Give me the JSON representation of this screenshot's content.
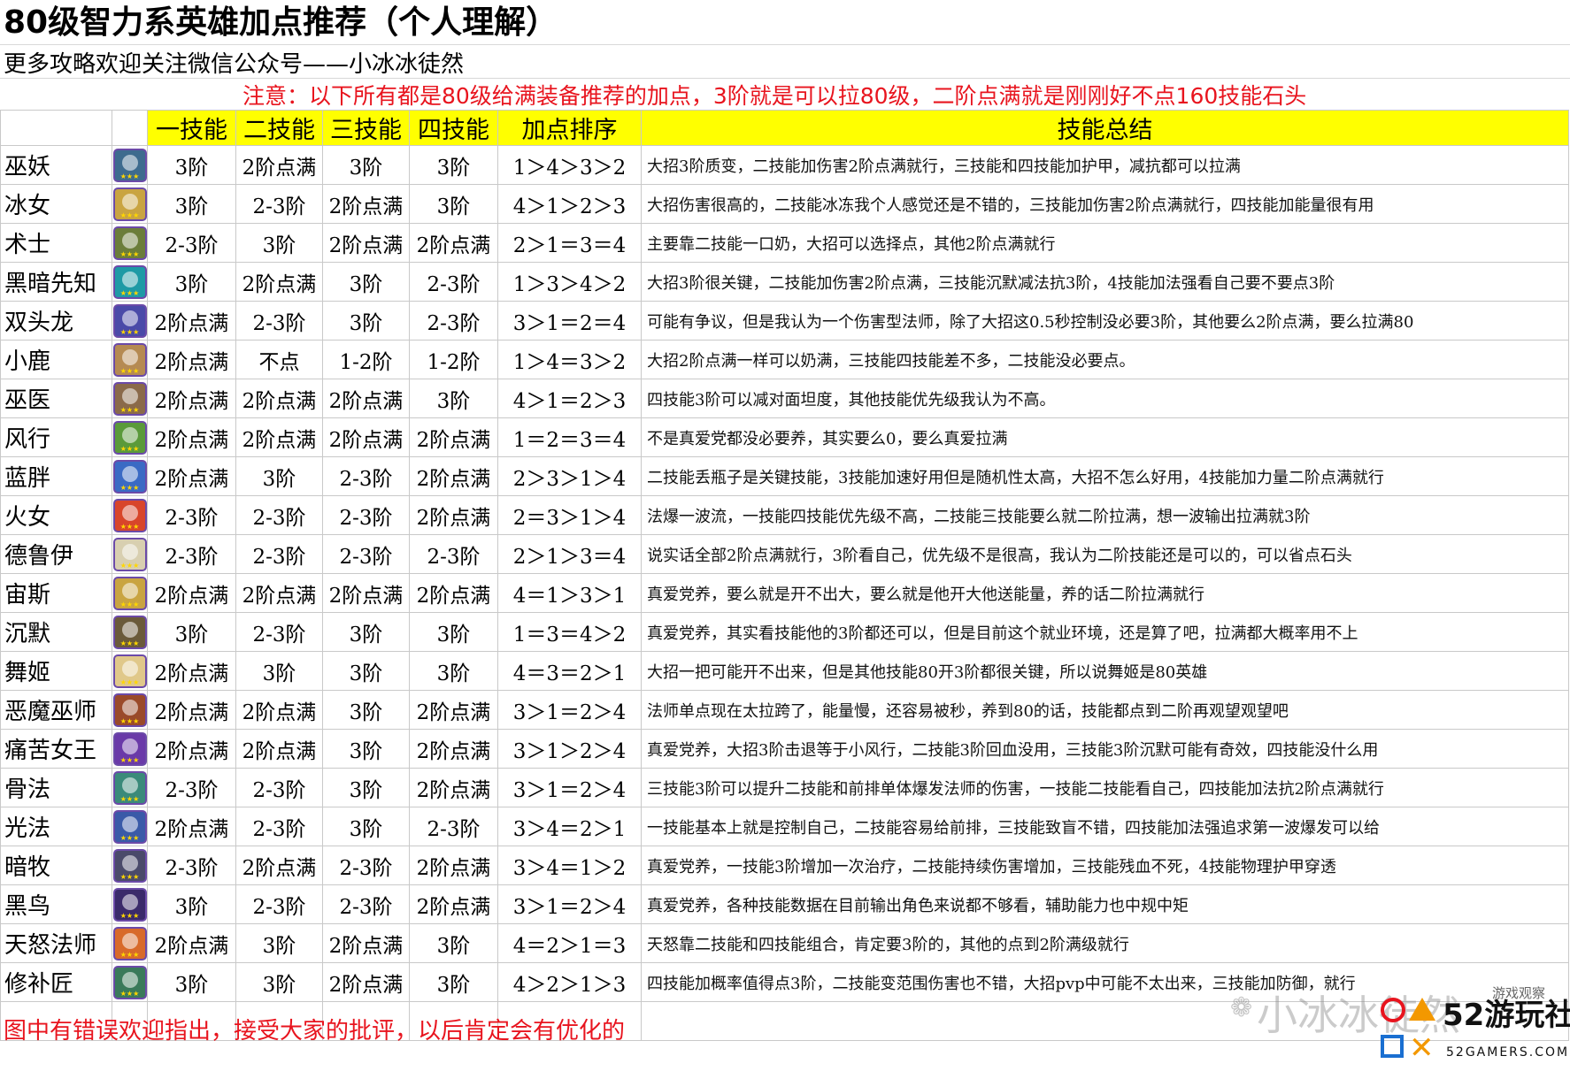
{
  "title": "80级智力系英雄加点推荐（个人理解）",
  "subtitle": "更多攻略欢迎关注微信公众号——小冰冰徒然",
  "notice": "注意：以下所有都是80级给满装备推荐的加点，3阶就是可以拉80级，二阶点满就是刚刚好不点160技能石头",
  "headers": [
    "一技能",
    "二技能",
    "三技能",
    "四技能",
    "加点排序",
    "技能总结"
  ],
  "rows": [
    {
      "name": "巫妖",
      "s1": "3阶",
      "s2": "2阶点满",
      "s3": "3阶",
      "s4": "3阶",
      "order": "1＞4＞3＞2",
      "summary": "大招3阶质变，二技能加伤害2阶点满就行，三技能和四技能加护甲，减抗都可以拉满",
      "color": "#3d6b8e"
    },
    {
      "name": "冰女",
      "s1": "3阶",
      "s2": "2-3阶",
      "s3": "2阶点满",
      "s4": "3阶",
      "order": "4＞1＞2＞3",
      "summary": "大招伤害很高的，二技能冰冻我个人感觉还是不错的，三技能加伤害2阶点满就行，四技能加能量很有用",
      "color": "#c9a441"
    },
    {
      "name": "术士",
      "s1": "2-3阶",
      "s2": "3阶",
      "s3": "2阶点满",
      "s4": "2阶点满",
      "order": "2＞1＝3＝4",
      "summary": "主要靠二技能一口奶，大招可以选择点，其他2阶点满就行",
      "color": "#6b7d3a"
    },
    {
      "name": "黑暗先知",
      "s1": "3阶",
      "s2": "2阶点满",
      "s3": "3阶",
      "s4": "2-3阶",
      "order": "1＞3＞4＞2",
      "summary": "大招3阶很关键，二技能加伤害2阶点满，三技能沉默减法抗3阶，4技能加法强看自己要不要点3阶",
      "color": "#1e9aa5"
    },
    {
      "name": "双头龙",
      "s1": "2阶点满",
      "s2": "2-3阶",
      "s3": "3阶",
      "s4": "2-3阶",
      "order": "3＞1＝2＝4",
      "summary": "可能有争议，但是我认为一个伤害型法师，除了大招这0.5秒控制没必要3阶，其他要么2阶点满，要么拉满80",
      "color": "#4a4aa8"
    },
    {
      "name": "小鹿",
      "s1": "2阶点满",
      "s2": "不点",
      "s3": "1-2阶",
      "s4": "1-2阶",
      "order": "1＞4＝3＞2",
      "summary": "大招2阶点满一样可以奶满，三技能四技能差不多，二技能没必要点。",
      "color": "#b58a52"
    },
    {
      "name": "巫医",
      "s1": "2阶点满",
      "s2": "2阶点满",
      "s3": "2阶点满",
      "s4": "3阶",
      "order": "4＞1＝2＞3",
      "summary": "四技能3阶可以减对面坦度，其他技能优先级我认为不高。",
      "color": "#8a6a4a"
    },
    {
      "name": "风行",
      "s1": "2阶点满",
      "s2": "2阶点满",
      "s3": "2阶点满",
      "s4": "2阶点满",
      "order": "1＝2＝3＝4",
      "summary": "不是真爱党都没必要养，其实要么0，要么真爱拉满",
      "color": "#5a9a3a"
    },
    {
      "name": "蓝胖",
      "s1": "2阶点满",
      "s2": "3阶",
      "s3": "2-3阶",
      "s4": "2阶点满",
      "order": "2＞3＞1＞4",
      "summary": "二技能丢瓶子是关键技能，3技能加速好用但是随机性太高，大招不怎么好用，4技能加力量二阶点满就行",
      "color": "#3a6ac4"
    },
    {
      "name": "火女",
      "s1": "2-3阶",
      "s2": "2-3阶",
      "s3": "2-3阶",
      "s4": "2阶点满",
      "order": "2＝3＞1＞4",
      "summary": "法爆一波流，一技能四技能优先级不高，二技能三技能要么就二阶拉满，想一波输出拉满就3阶",
      "color": "#d8452a"
    },
    {
      "name": "德鲁伊",
      "s1": "2-3阶",
      "s2": "2-3阶",
      "s3": "2-3阶",
      "s4": "2-3阶",
      "order": "2＞1＞3＝4",
      "summary": "说实话全部2阶点满就行，3阶看自己，优先级不是很高，我认为二阶技能还是可以的，可以省点石头",
      "color": "#d8cfb0"
    },
    {
      "name": "宙斯",
      "s1": "2阶点满",
      "s2": "2阶点满",
      "s3": "2阶点满",
      "s4": "2阶点满",
      "order": "4＝1＞3＞1",
      "summary": "真爱党养，要么就是开不出大，要么就是他开大他送能量，养的话二阶拉满就行",
      "color": "#c9a441"
    },
    {
      "name": "沉默",
      "s1": "3阶",
      "s2": "2-3阶",
      "s3": "3阶",
      "s4": "3阶",
      "order": "1＝3＝4＞2",
      "summary": "真爱党养，其实看技能他的3阶都还可以，但是目前这个就业环境，还是算了吧，拉满都大概率用不上",
      "color": "#6a5a3a"
    },
    {
      "name": "舞姬",
      "s1": "2阶点满",
      "s2": "3阶",
      "s3": "3阶",
      "s4": "3阶",
      "order": "4＝3＝2＞1",
      "summary": "大招一把可能开不出来，但是其他技能80开3阶都很关键，所以说舞姬是80英雄",
      "color": "#e0c88a"
    },
    {
      "name": "恶魔巫师",
      "s1": "2阶点满",
      "s2": "2阶点满",
      "s3": "3阶",
      "s4": "2阶点满",
      "order": "3＞1＝2＞4",
      "summary": "法师单点现在太拉跨了，能量慢，还容易被秒，养到80的话，技能都点到二阶再观望观望吧",
      "color": "#9a4a2a"
    },
    {
      "name": "痛苦女王",
      "s1": "2阶点满",
      "s2": "2阶点满",
      "s3": "3阶",
      "s4": "2阶点满",
      "order": "3＞1＞2＞4",
      "summary": "真爱党养，大招3阶击退等于小风行，二技能3阶回血没用，三技能3阶沉默可能有奇效，四技能没什么用",
      "color": "#6a3aa8"
    },
    {
      "name": "骨法",
      "s1": "2-3阶",
      "s2": "2-3阶",
      "s3": "3阶",
      "s4": "2阶点满",
      "order": "3＞1＝2＞4",
      "summary": "三技能3阶可以提升二技能和前排单体爆发法师的伤害，一技能二技能看自己，四技能加法抗2阶点满就行",
      "color": "#3a8a7a"
    },
    {
      "name": "光法",
      "s1": "2阶点满",
      "s2": "2-3阶",
      "s3": "3阶",
      "s4": "2-3阶",
      "order": "3＞4＝2＞1",
      "summary": "一技能基本上就是控制自己，二技能容易给前排，三技能致盲不错，四技能加法强追求第一波爆发可以给",
      "color": "#3a5aa8"
    },
    {
      "name": "暗牧",
      "s1": "2-3阶",
      "s2": "2阶点满",
      "s3": "2-3阶",
      "s4": "2阶点满",
      "order": "3＞4＝1＞2",
      "summary": "真爱党养，一技能3阶增加一次治疗，二技能持续伤害增加，三技能残血不死，4技能物理护甲穿透",
      "color": "#4a4a6a"
    },
    {
      "name": "黑鸟",
      "s1": "3阶",
      "s2": "2-3阶",
      "s3": "2-3阶",
      "s4": "2阶点满",
      "order": "3＞1＝2＞4",
      "summary": "真爱党养，各种技能数据在目前输出角色来说都不够看，辅助能力也中规中矩",
      "color": "#3a2a6a"
    },
    {
      "name": "天怒法师",
      "s1": "2阶点满",
      "s2": "3阶",
      "s3": "2阶点满",
      "s4": "3阶",
      "order": "4＝2＞1＝3",
      "summary": "天怒靠二技能和四技能组合，肯定要3阶的，其他的点到2阶满级就行",
      "color": "#d86a2a"
    },
    {
      "name": "修补匠",
      "s1": "3阶",
      "s2": "3阶",
      "s3": "2阶点满",
      "s4": "3阶",
      "order": "4＞2＞1＞3",
      "summary": "四技能加概率值得点3阶，二技能变范围伤害也不错，大招pvp中可能不太出来，三技能加防御，就行",
      "color": "#3a7a5a"
    }
  ],
  "footer": "图中有错误欢迎指出，接受大家的批评，以后肯定会有优化的",
  "watermark": "小冰冰徒然",
  "logo": {
    "brand": "52游玩社区",
    "site": "52GAMERS.COM",
    "tag": "游戏观察"
  }
}
